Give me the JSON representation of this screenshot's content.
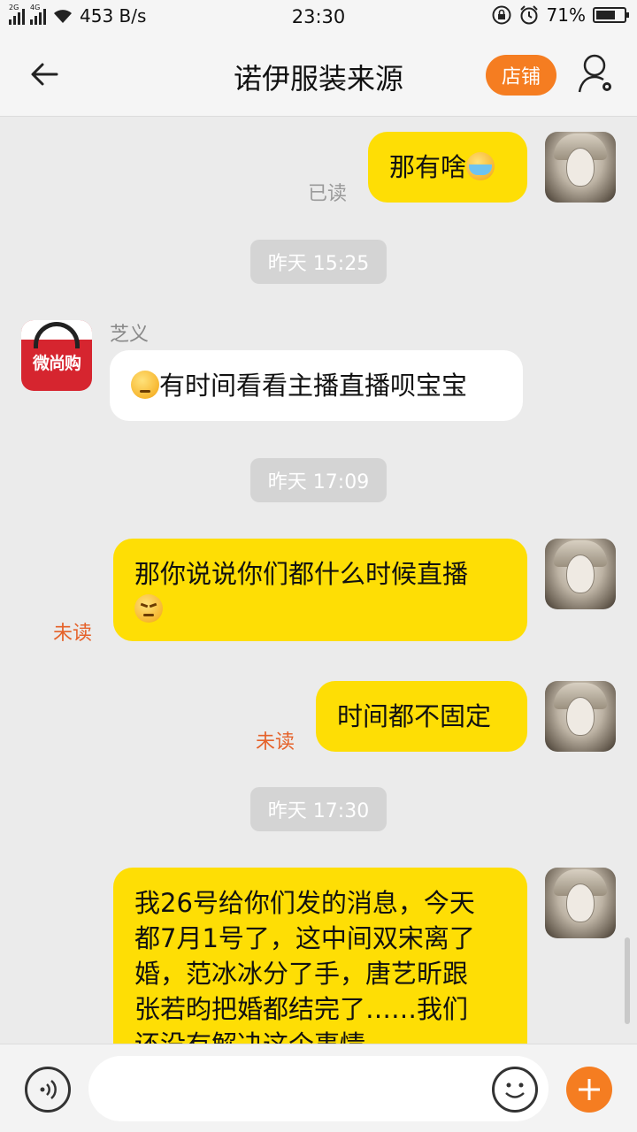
{
  "status_bar": {
    "net_labels": [
      "2G",
      "4G"
    ],
    "speed": "453 B/s",
    "time": "23:30",
    "battery": "71%",
    "battery_level": 0.71
  },
  "header": {
    "title": "诺伊服装来源",
    "shop_label": "店铺"
  },
  "messages": {
    "m1": {
      "text": "那有啥",
      "status": "已读"
    },
    "t1": "昨天  15:25",
    "m2": {
      "sender": "芝义",
      "avatar_text": "微尚购",
      "text": "有时间看看主播直播呗宝宝"
    },
    "t2": "昨天  17:09",
    "m3": {
      "line1": "那你说说你们都什么时候直播",
      "status": "未读"
    },
    "m4": {
      "text": "时间都不固定",
      "status": "未读"
    },
    "t3": "昨天  17:30",
    "m5": {
      "lines": [
        "我26号给你们发的消息，今天",
        "都7月1号了，这中间双宋离了",
        "婚，范冰冰分了手，唐艺昕跟",
        "张若昀把婚都结完了……我们",
        "还没有解决这个事情"
      ]
    }
  },
  "colors": {
    "accent": "#f57d21",
    "my_bubble": "#fede05",
    "unread": "#e5622a"
  },
  "icons": [
    "back-arrow-icon",
    "user-settings-icon",
    "voice-icon",
    "emoji-icon",
    "plus-icon",
    "alarm-icon",
    "lock-icon",
    "wifi-icon"
  ]
}
